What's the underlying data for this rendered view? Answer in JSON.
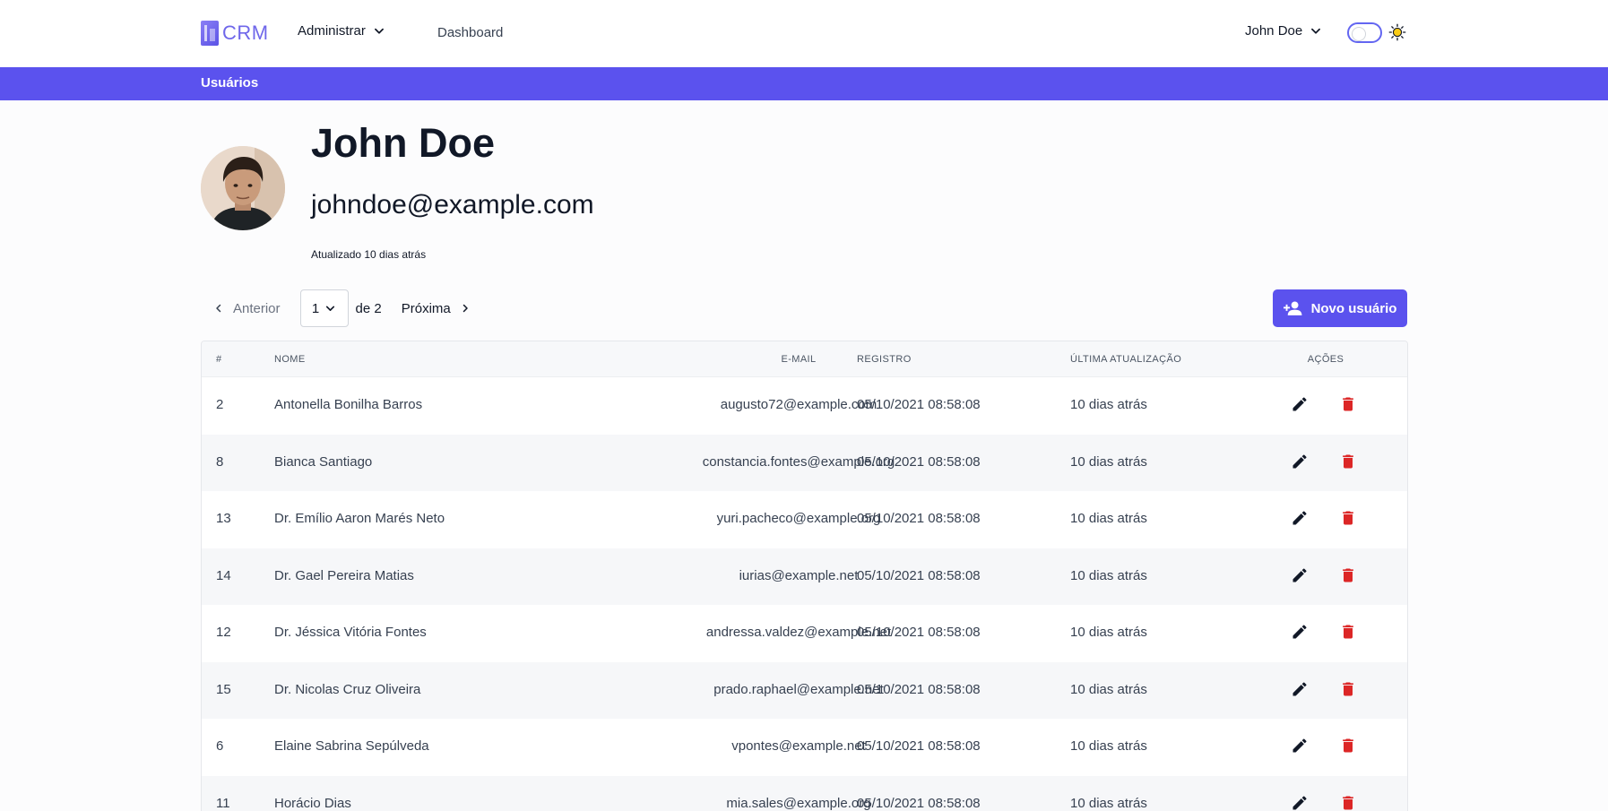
{
  "brand": {
    "name": "CRM",
    "accent": "#5b52ee"
  },
  "nav": {
    "admin_label": "Administrar",
    "dashboard_label": "Dashboard",
    "user_label": "John Doe"
  },
  "banner": {
    "title": "Usuários"
  },
  "profile": {
    "name": "John Doe",
    "email": "johndoe@example.com",
    "updated": "Atualizado 10 dias atrás"
  },
  "pagination": {
    "prev_label": "Anterior",
    "current_page": "1",
    "of_label": "de 2",
    "next_label": "Próxima"
  },
  "actions": {
    "new_user_label": "Novo usuário"
  },
  "table": {
    "headers": {
      "num": "#",
      "name": "NOME",
      "email": "E-MAIL",
      "registered": "REGISTRO",
      "updated": "ÚLTIMA ATUALIZAÇÃO",
      "actions": "AÇÕES"
    },
    "rows": [
      {
        "num": "2",
        "name": "Antonella Bonilha Barros",
        "email": "augusto72@example.com",
        "registered": "05/10/2021 08:58:08",
        "updated": "10 dias atrás"
      },
      {
        "num": "8",
        "name": "Bianca Santiago",
        "email": "constancia.fontes@example.org",
        "registered": "05/10/2021 08:58:08",
        "updated": "10 dias atrás"
      },
      {
        "num": "13",
        "name": "Dr. Emílio Aaron Marés Neto",
        "email": "yuri.pacheco@example.org",
        "registered": "05/10/2021 08:58:08",
        "updated": "10 dias atrás"
      },
      {
        "num": "14",
        "name": "Dr. Gael Pereira Matias",
        "email": "iurias@example.net",
        "registered": "05/10/2021 08:58:08",
        "updated": "10 dias atrás"
      },
      {
        "num": "12",
        "name": "Dr. Jéssica Vitória Fontes",
        "email": "andressa.valdez@example.net",
        "registered": "05/10/2021 08:58:08",
        "updated": "10 dias atrás"
      },
      {
        "num": "15",
        "name": "Dr. Nicolas Cruz Oliveira",
        "email": "prado.raphael@example.net",
        "registered": "05/10/2021 08:58:08",
        "updated": "10 dias atrás"
      },
      {
        "num": "6",
        "name": "Elaine Sabrina Sepúlveda",
        "email": "vpontes@example.net",
        "registered": "05/10/2021 08:58:08",
        "updated": "10 dias atrás"
      },
      {
        "num": "11",
        "name": "Horácio Dias",
        "email": "mia.sales@example.org",
        "registered": "05/10/2021 08:58:08",
        "updated": "10 dias atrás"
      }
    ]
  },
  "icons": {
    "edit": "pencil-icon",
    "delete": "trash-icon",
    "delete_color": "#dc2626",
    "theme": "sun-icon"
  }
}
